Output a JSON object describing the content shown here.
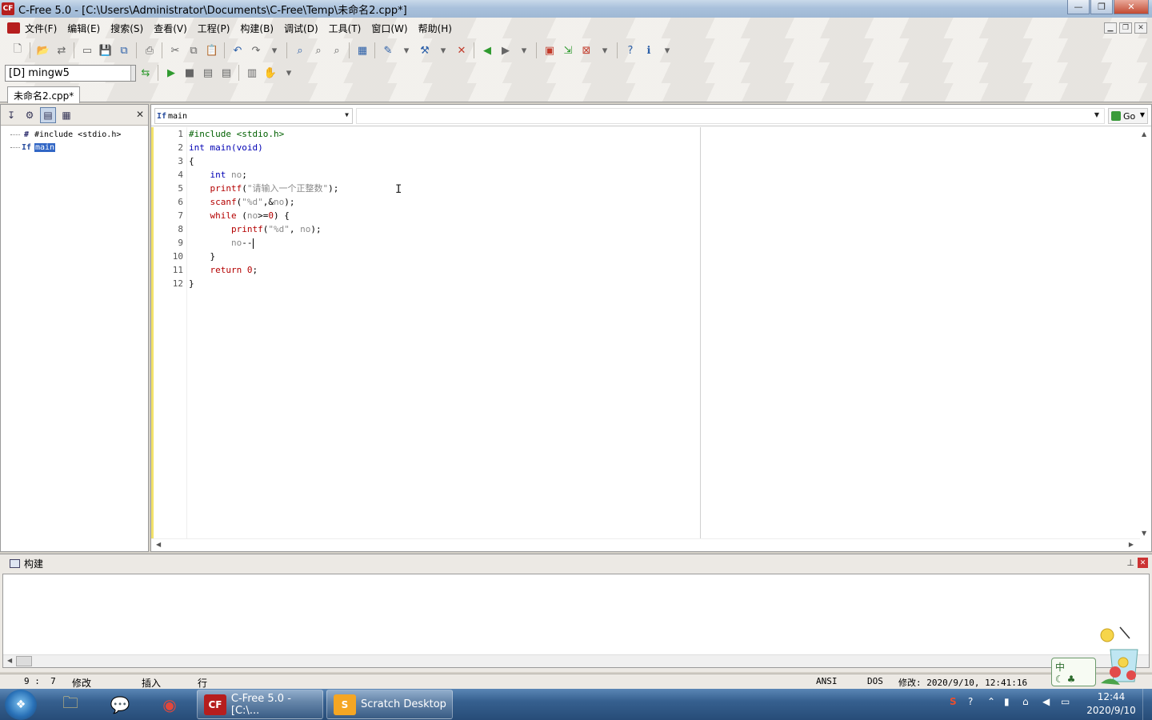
{
  "window": {
    "app_icon": "CF",
    "title": "C-Free 5.0 - [C:\\Users\\Administrator\\Documents\\C-Free\\Temp\\未命名2.cpp*]",
    "controls": [
      "minimize-icon",
      "restore-icon",
      "close-icon"
    ]
  },
  "menu": {
    "items": [
      "文件(F)",
      "编辑(E)",
      "搜索(S)",
      "查看(V)",
      "工程(P)",
      "构建(B)",
      "调试(D)",
      "工具(T)",
      "窗口(W)",
      "帮助(H)"
    ]
  },
  "toolbar2": {
    "compiler": "[D] mingw5"
  },
  "tabs": {
    "active": "未命名2.cpp*"
  },
  "class_view": {
    "items": [
      {
        "icon": "#",
        "label": "#include <stdio.h>"
      },
      {
        "icon": "If",
        "label": "main",
        "selected": true
      }
    ]
  },
  "editor": {
    "function_select": "main",
    "function_icon": "If",
    "go_label": "Go",
    "lines": [
      {
        "n": "1"
      },
      {
        "n": "2"
      },
      {
        "n": "3"
      },
      {
        "n": "4"
      },
      {
        "n": "5"
      },
      {
        "n": "6"
      },
      {
        "n": "7"
      },
      {
        "n": "8"
      },
      {
        "n": "9"
      },
      {
        "n": "10"
      },
      {
        "n": "11"
      },
      {
        "n": "12"
      }
    ],
    "code": {
      "l1a": "#include",
      "l1b": " <stdio.h>",
      "l2a": "int",
      "l2b": " main(void)",
      "l3": "{",
      "l4a": "    int",
      "l4b": " no",
      "l4c": ";",
      "l5a": "    printf",
      "l5b": "(",
      "l5c": "\"请输入一个正整数\"",
      "l5d": ");",
      "l6a": "    scanf",
      "l6b": "(",
      "l6c": "\"%d\"",
      "l6d": ",&",
      "l6e": "no",
      "l6f": ");",
      "l7a": "    while",
      "l7b": " (",
      "l7c": "no",
      "l7d": ">=",
      "l7e": "0",
      "l7f": ") {",
      "l8a": "        printf",
      "l8b": "(",
      "l8c": "\"%d\"",
      "l8d": ", ",
      "l8e": "no",
      "l8f": ");",
      "l9a": "        no",
      "l9b": "--",
      "l10": "    }",
      "l11a": "    return",
      "l11b": " ",
      "l11c": "0",
      "l11d": ";",
      "l12": "}"
    }
  },
  "build_panel": {
    "title": "构建"
  },
  "status_bar": {
    "position": "9 :  7",
    "modified": "修改",
    "insert": "插入",
    "line": "行",
    "encoding": "ANSI",
    "line_ending": "DOS",
    "modified_time": "修改: 2020/9/10, 12:41:16"
  },
  "ime": {
    "label": "中"
  },
  "taskbar": {
    "windows": [
      {
        "label": "C-Free 5.0 - [C:\\...",
        "icon": "CF"
      },
      {
        "label": "Scratch Desktop",
        "icon": "S"
      }
    ],
    "clock_time": "12:44",
    "clock_date": "2020/9/10"
  },
  "colors": {
    "keyword": "#0000b4",
    "string": "#8a8a8a",
    "number": "#b40000",
    "preprocessor": "#006000",
    "selection": "#3166c5"
  }
}
